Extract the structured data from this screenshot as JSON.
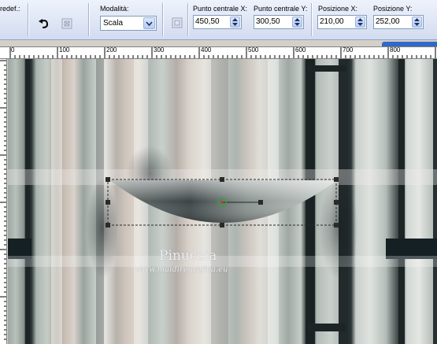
{
  "toolbar": {
    "preset_label": "redef.:",
    "mode_label": "Modalità:",
    "mode_value": "Scala",
    "center_x_label": "Punto centrale X:",
    "center_x_value": "450,50",
    "center_y_label": "Punto centrale Y:",
    "center_y_value": "300,50",
    "pos_x_label": "Posizione X:",
    "pos_x_value": "210,00",
    "pos_y_label": "Posizione Y:",
    "pos_y_value": "252,00"
  },
  "icons": {
    "reset": "undo-arrow-icon",
    "apply": "stamp-icon",
    "center": "center-point-icon",
    "combo_arrow": "chevron-down-icon",
    "spin": "spin-arrows-icon"
  },
  "ruler": {
    "h_ticks": [
      "0",
      "100",
      "200",
      "300",
      "400",
      "500",
      "600",
      "700",
      "800"
    ]
  },
  "watermark": {
    "name": "Pinuccia",
    "site": "www.maidiregrafica.eu"
  },
  "colors": {
    "toolbar_bg": "#dfe6f5",
    "selection_handle": "#2a2a2a",
    "rotation_pivot": "#3f9a3f",
    "tab_accent": "#3169c6"
  }
}
